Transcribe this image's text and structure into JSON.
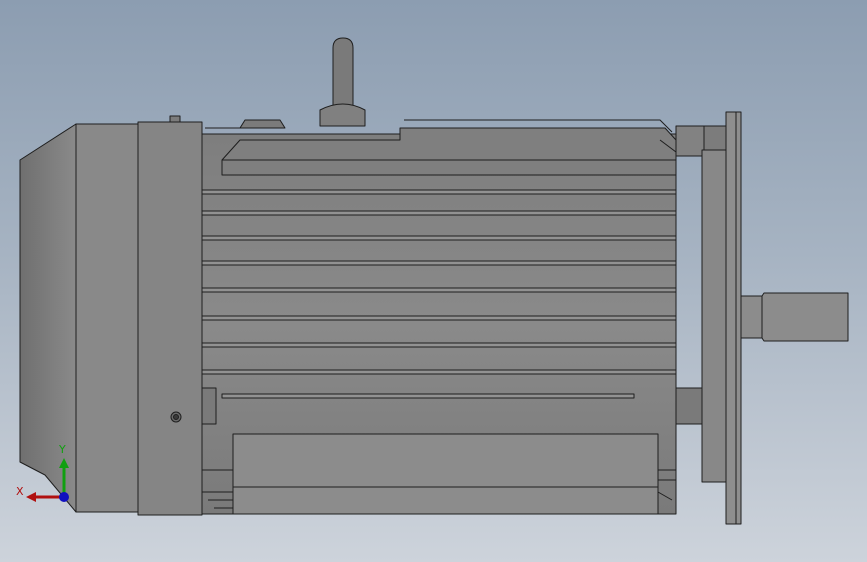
{
  "viewport": {
    "background_top": "#8c9db1",
    "background_bottom": "#cdd3db"
  },
  "model": {
    "body_color": "#858585",
    "edge_color": "#1e1e1e"
  },
  "triad": {
    "x_label": "X",
    "y_label": "Y",
    "x_color": "#b01010",
    "y_color": "#10a010",
    "z_color": "#1010c0"
  }
}
